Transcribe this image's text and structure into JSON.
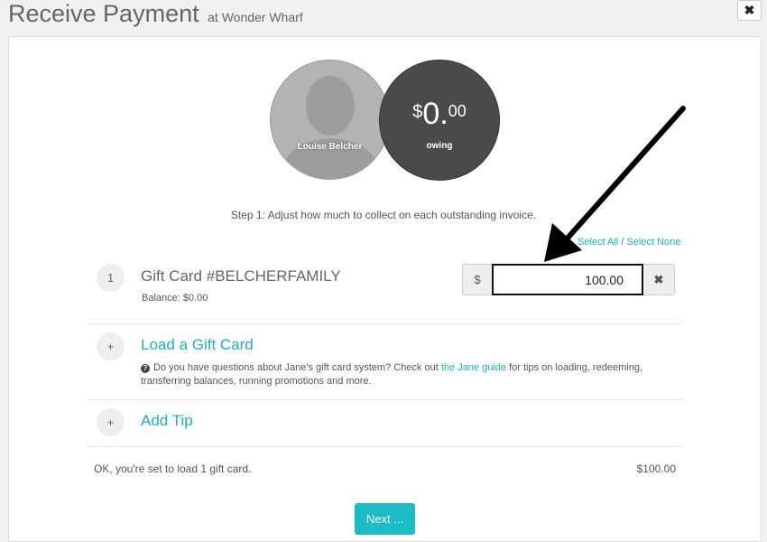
{
  "header": {
    "title": "Receive Payment",
    "subtitle": "at Wonder Wharf",
    "close_icon": "close-icon"
  },
  "client": {
    "name": "Louise Belcher",
    "avatar_icon": "person-silhouette"
  },
  "balance_summary": {
    "currency": "$",
    "whole": "0",
    "decimal_point": ".",
    "cents": "00",
    "label": "owing"
  },
  "step": {
    "instruction": "Step 1: Adjust how much to collect on each outstanding invoice."
  },
  "selection": {
    "select_all": "Select All",
    "separator": "/",
    "select_none": "Select None"
  },
  "items": {
    "gift_card": {
      "number": "1",
      "title": "Gift Card #BELCHERFAMILY",
      "balance": "Balance: $0.00",
      "currency_symbol": "$",
      "amount": "100.00",
      "clear_icon": "times-icon"
    },
    "load_gift_card": {
      "icon": "+",
      "title": "Load a Gift Card",
      "help_prefix": "Do you have questions about Jane's gift card system? Check out ",
      "help_link": "the Jane guide",
      "help_suffix": " for tips on loading, redeeming, transferring balances, running promotions and more.",
      "question_icon": "?"
    },
    "add_tip": {
      "icon": "+",
      "title": "Add Tip"
    }
  },
  "summary": {
    "message": "OK, you're set to load 1 gift card.",
    "total": "$100.00"
  },
  "actions": {
    "next_label": "Next ..."
  },
  "colors": {
    "accent": "#1bb1c3",
    "button": "#1bbcc6",
    "owing_circle": "#4a4a4a"
  }
}
